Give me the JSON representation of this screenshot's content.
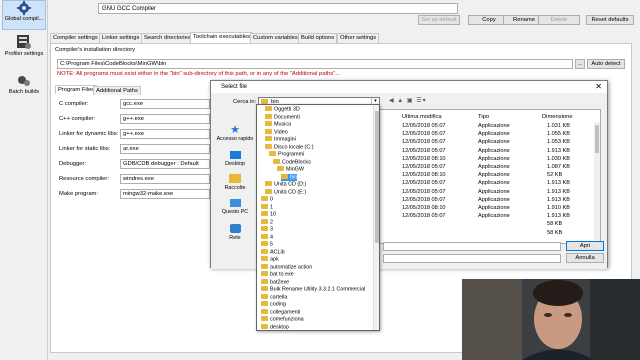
{
  "window": {
    "title": "GNU GCC Compiler"
  },
  "left_panel": {
    "items": [
      {
        "label": "Global compil...",
        "icon": "gear-icon"
      },
      {
        "label": "Profiler settings",
        "icon": "profiler-icon"
      },
      {
        "label": "Batch builds",
        "icon": "batch-builds-icon"
      }
    ]
  },
  "toolbar": {
    "set_default": "Set as default",
    "copy": "Copy",
    "rename": "Rename",
    "delete": "Delete",
    "reset_defaults": "Reset defaults"
  },
  "tabs": [
    "Compiler settings",
    "Linker settings",
    "Search directories",
    "Toolchain executables",
    "Custom variables",
    "Build options",
    "Other settings"
  ],
  "toolchain": {
    "install_dir_label": "Compiler's installation directory",
    "install_dir_value": "C:\\Program Files\\CodeBlocks\\MinGW\\bin",
    "auto_detect": "Auto detect",
    "ellipsis": "...",
    "note": "NOTE: All programs must exist either in the \"bin\" sub-directory of this path, or in any of the \"Additional paths\"...",
    "inner_tabs": [
      "Program Files",
      "Additional Paths"
    ],
    "fields": [
      {
        "label": "C compiler:",
        "value": "gcc.exe"
      },
      {
        "label": "C++ compiler:",
        "value": "g++.exe"
      },
      {
        "label": "Linker for dynamic libs:",
        "value": "g++.exe"
      },
      {
        "label": "Linker for static libs:",
        "value": "ar.exe"
      },
      {
        "label": "Debugger:",
        "value": "GDB/CDB debugger : Default"
      },
      {
        "label": "Resource compiler:",
        "value": "windres.exe"
      },
      {
        "label": "Make program:",
        "value": "mingw32-make.exe"
      }
    ]
  },
  "select_file": {
    "title": "Select file",
    "look_in_label": "Cerca in:",
    "look_in_value": "bin",
    "places": [
      "Accesso rapido",
      "Desktop",
      "Raccolte",
      "Questo PC",
      "Rete"
    ],
    "columns": [
      "Ultima modifica",
      "Tipo",
      "Dimensione"
    ],
    "rows": [
      {
        "date": "12/05/2018 05:07",
        "type": "Applicazione",
        "size": "1.031 KB"
      },
      {
        "date": "12/05/2018 05:07",
        "type": "Applicazione",
        "size": "1.055 KB"
      },
      {
        "date": "12/05/2018 05:07",
        "type": "Applicazione",
        "size": "1.053 KB"
      },
      {
        "date": "12/05/2018 05:07",
        "type": "Applicazione",
        "size": "1.913 KB"
      },
      {
        "date": "12/05/2018 08:10",
        "type": "Applicazione",
        "size": "1.030 KB"
      },
      {
        "date": "12/05/2018 05:07",
        "type": "Applicazione",
        "size": "1.087 KB"
      },
      {
        "date": "12/05/2018 08:10",
        "type": "Applicazione",
        "size": "52 KB"
      },
      {
        "date": "12/05/2018 05:07",
        "type": "Applicazione",
        "size": "1.913 KB"
      },
      {
        "date": "12/05/2018 05:07",
        "type": "Applicazione",
        "size": "1.913 KB"
      },
      {
        "date": "12/05/2018 05:07",
        "type": "Applicazione",
        "size": "1.913 KB"
      },
      {
        "date": "12/05/2018 08:10",
        "type": "Applicazione",
        "size": "1.910 KB"
      },
      {
        "date": "12/05/2018 05:07",
        "type": "Applicazione",
        "size": "1.913 KB"
      },
      {
        "date": "",
        "type": "",
        "size": "58 KB"
      },
      {
        "date": "",
        "type": "",
        "size": "58 KB"
      }
    ],
    "open_button": "Apri",
    "cancel_button": "Annulla"
  },
  "dropdown": {
    "items": [
      {
        "label": "Oggetti 3D",
        "indent": 1
      },
      {
        "label": "Documenti",
        "indent": 1
      },
      {
        "label": "Musica",
        "indent": 1
      },
      {
        "label": "Video",
        "indent": 1
      },
      {
        "label": "Immagini",
        "indent": 1
      },
      {
        "label": "Disco locale (C:)",
        "indent": 1
      },
      {
        "label": "Programmi",
        "indent": 2
      },
      {
        "label": "CodeBlocks",
        "indent": 3
      },
      {
        "label": "MinGW",
        "indent": 4
      },
      {
        "label": "bin",
        "indent": 5,
        "selected": true
      },
      {
        "label": "Unità CD (D:)",
        "indent": 1
      },
      {
        "label": "Unità CD (E:)",
        "indent": 1
      },
      {
        "label": "0",
        "indent": 0
      },
      {
        "label": "1",
        "indent": 0
      },
      {
        "label": "10",
        "indent": 0
      },
      {
        "label": "2",
        "indent": 0
      },
      {
        "label": "3",
        "indent": 0
      },
      {
        "label": "4",
        "indent": 0
      },
      {
        "label": "5",
        "indent": 0
      },
      {
        "label": "ACLib",
        "indent": 0
      },
      {
        "label": "apk",
        "indent": 0
      },
      {
        "label": "automatize action",
        "indent": 0
      },
      {
        "label": "bat to exe",
        "indent": 0
      },
      {
        "label": "bat2exe",
        "indent": 0
      },
      {
        "label": "Bulk Rename Utility 3.3.2.1 Commercial",
        "indent": 0
      },
      {
        "label": "cartella",
        "indent": 0
      },
      {
        "label": "coding",
        "indent": 0
      },
      {
        "label": "collegamenti",
        "indent": 0
      },
      {
        "label": "comefunziona",
        "indent": 0
      },
      {
        "label": "desktop",
        "indent": 0
      }
    ]
  }
}
